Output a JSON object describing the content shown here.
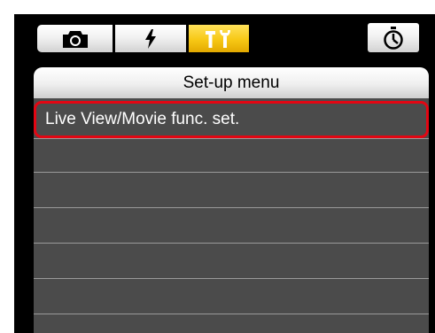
{
  "tabs": [
    {
      "icon": "camera-icon",
      "active": false
    },
    {
      "icon": "flash-icon",
      "active": false
    },
    {
      "icon": "setup-tools-icon",
      "active": true
    },
    {
      "icon": "timer-icon",
      "active": false
    }
  ],
  "colors": {
    "active_tab": "#f7c815",
    "selection_border": "#e30613",
    "panel_bg": "#4b4b4b",
    "screen_bg": "#000000"
  },
  "menu": {
    "title": "Set-up menu",
    "items": [
      {
        "label": "Live View/Movie func. set.",
        "selected": true
      },
      {
        "label": ""
      },
      {
        "label": ""
      },
      {
        "label": ""
      },
      {
        "label": ""
      },
      {
        "label": ""
      }
    ]
  }
}
